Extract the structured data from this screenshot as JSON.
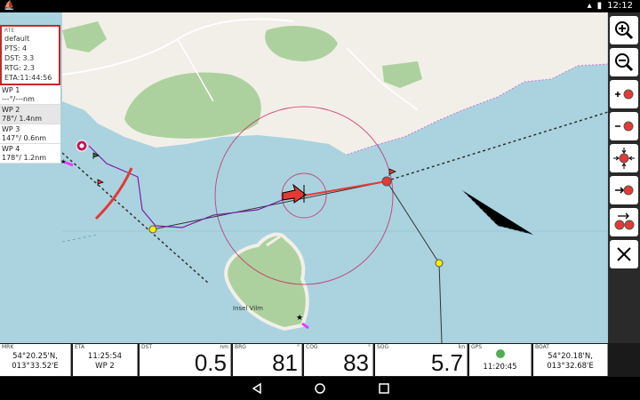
{
  "status": {
    "time": "12:12"
  },
  "route": {
    "header": "RTE",
    "name": "default",
    "pts": "PTS: 4",
    "dst": "DST: 3.3",
    "rtg": "RTG: 2.3",
    "eta": "ETA:11:44:56"
  },
  "waypoints": [
    {
      "name": "WP 1",
      "info": "---°/---nm"
    },
    {
      "name": "WP 2",
      "info": "78°/ 1.4nm"
    },
    {
      "name": "WP 3",
      "info": "147°/ 0.6nm"
    },
    {
      "name": "WP 4",
      "info": "178°/ 1.2nm"
    }
  ],
  "map": {
    "island_label": "Insel Vilm"
  },
  "toolbar": {
    "buttons": [
      "zoom-in-icon",
      "zoom-out-icon",
      "add-waypoint-icon",
      "remove-waypoint-icon",
      "center-boat-icon",
      "goto-waypoint-icon",
      "route-waypoints-icon",
      "close-icon"
    ]
  },
  "databar": {
    "mrk": {
      "label": "MRK",
      "lat": "54°20.25'N,",
      "lon": "013°33.52'E"
    },
    "eta": {
      "label": "ETA",
      "time": "11:25:54",
      "wp": "WP 2"
    },
    "dst": {
      "label": "DST",
      "unit": "nm",
      "value": "0.5"
    },
    "brg": {
      "label": "BRG",
      "unit": "°",
      "value": "81"
    },
    "cog": {
      "label": "COG",
      "unit": "°",
      "value": "83"
    },
    "sog": {
      "label": "SOG",
      "unit": "kn",
      "value": "5.7"
    },
    "gps": {
      "label": "GPS",
      "time": "11:20:45"
    },
    "boat": {
      "label": "BOAT",
      "lat": "54°20.18'N,",
      "lon": "013°32.68'E"
    }
  },
  "colors": {
    "water": "#aad3df",
    "land": "#f2efe9",
    "forest": "#add19e",
    "route": "#e53935",
    "track": "#7b1fa2",
    "waypoint": "#ffee00",
    "gps_ok": "#4caf50"
  }
}
